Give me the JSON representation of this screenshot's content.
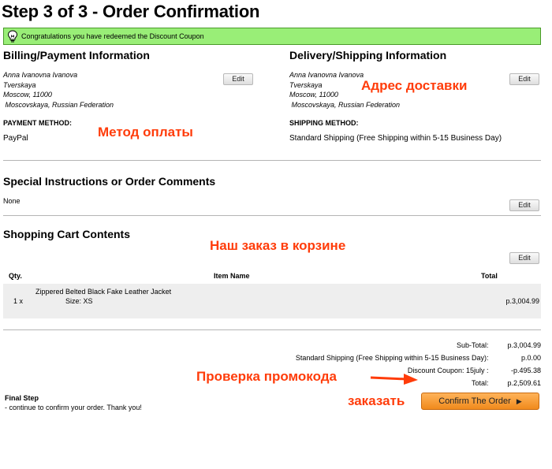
{
  "page": {
    "title": "Step 3 of 3 - Order Confirmation"
  },
  "notice": {
    "text": "Congratulations you have redeemed the Discount Coupon",
    "color": "#99ee77",
    "icon": "lightbulb-icon"
  },
  "billing": {
    "heading": "Billing/Payment Information",
    "address": [
      "Anna Ivanovna Ivanova",
      "Tverskaya",
      "Moscow, 11000",
      " Moscovskaya, Russian Federation"
    ],
    "edit_label": "Edit",
    "method_label": "PAYMENT METHOD:",
    "method_value": "PayPal"
  },
  "delivery": {
    "heading": "Delivery/Shipping Information",
    "address": [
      "Anna Ivanovna Ivanova",
      "Tverskaya",
      "Moscow, 11000",
      " Moscovskaya, Russian Federation"
    ],
    "edit_label": "Edit",
    "method_label": "SHIPPING METHOD:",
    "method_value": "Standard Shipping (Free Shipping within 5-15 Business Day)"
  },
  "comments": {
    "heading": "Special Instructions or Order Comments",
    "value": "None",
    "edit_label": "Edit"
  },
  "cart": {
    "heading": "Shopping Cart Contents",
    "edit_label": "Edit",
    "columns": {
      "qty": "Qty.",
      "item": "Item Name",
      "total": "Total"
    },
    "items": [
      {
        "qty": "1 x",
        "name": "Zippered Belted Black Fake Leather Jacket",
        "attribute": "Size: XS",
        "total": "р.3,004.99"
      }
    ]
  },
  "totals": [
    {
      "label": "Sub-Total:",
      "value": "р.3,004.99"
    },
    {
      "label": "Standard Shipping (Free Shipping within 5-15 Business Day):",
      "value": "р.0.00"
    },
    {
      "label": "Discount Coupon: 15july :",
      "value": "-р.495.38"
    },
    {
      "label": "Total:",
      "value": "р.2,509.61"
    }
  ],
  "final": {
    "heading": "Final Step",
    "text": "- continue to confirm your order. Thank you!",
    "button_label": "Confirm The Order"
  },
  "annotations": {
    "payment": "Метод оплаты",
    "delivery": "Адрес доставки",
    "cart": "Наш заказ в корзине",
    "coupon": "Проверка промокода",
    "order": "заказать",
    "color": "#ff3c0a"
  }
}
